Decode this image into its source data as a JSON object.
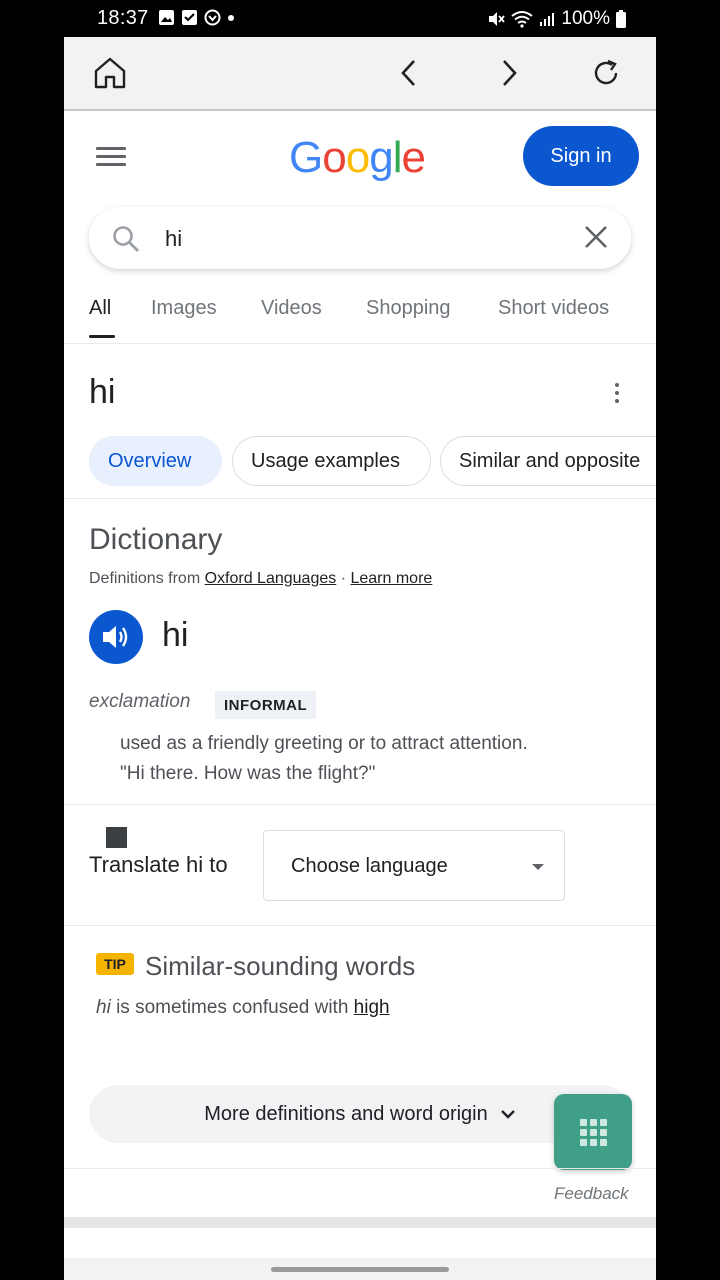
{
  "status_bar": {
    "time": "18:37",
    "battery": "100%"
  },
  "browser": {
    "icons": [
      "home-icon",
      "back-icon",
      "forward-icon",
      "refresh-icon"
    ]
  },
  "header": {
    "logo": "Google",
    "signin_label": "Sign in"
  },
  "search": {
    "query": "hi"
  },
  "tabs": [
    "All",
    "Images",
    "Videos",
    "Shopping",
    "Short videos"
  ],
  "result": {
    "term": "hi",
    "chips": [
      "Overview",
      "Usage examples",
      "Similar and opposite"
    ]
  },
  "dictionary": {
    "title": "Dictionary",
    "source_prefix": "Definitions from ",
    "source_link": "Oxford Languages",
    "separator": " · ",
    "learn_more": "Learn more",
    "word": "hi",
    "part_of_speech": "exclamation",
    "register": "INFORMAL",
    "definition": "used as a friendly greeting or to attract attention.",
    "example": "\"Hi there. How was the flight?\""
  },
  "translate": {
    "label": "Translate hi to",
    "select_value": "Choose language"
  },
  "similar": {
    "tip": "TIP",
    "title": "Similar-sounding words",
    "word": "hi",
    "middle": " is sometimes confused with ",
    "other": "high"
  },
  "more": {
    "label": "More definitions and word origin"
  },
  "feedback": {
    "label": "Feedback"
  },
  "colors": {
    "brand_blue": "#0b57d0",
    "fab_green": "#3f9f87",
    "tip_yellow": "#f5b400"
  }
}
